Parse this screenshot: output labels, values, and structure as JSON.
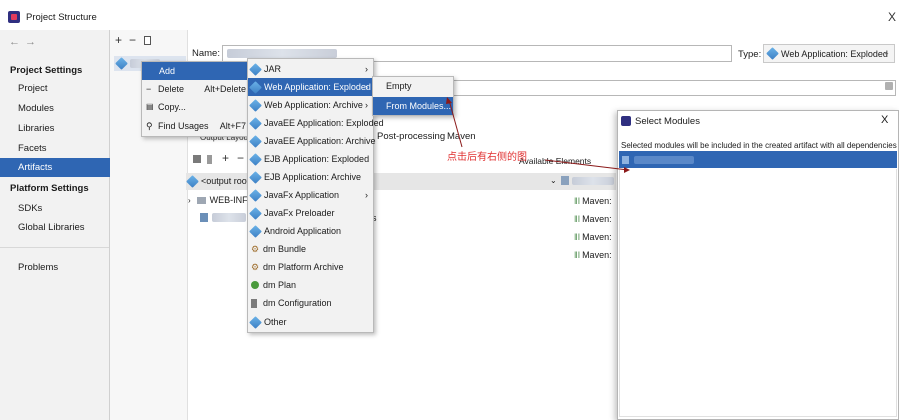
{
  "window": {
    "title": "Project Structure",
    "close": "X"
  },
  "nav": {
    "back": "←",
    "forward": "→"
  },
  "sidebar": {
    "project_settings": "Project Settings",
    "project_items": [
      {
        "label": "Project"
      },
      {
        "label": "Modules"
      },
      {
        "label": "Libraries"
      },
      {
        "label": "Facets"
      },
      {
        "label": "Artifacts"
      }
    ],
    "platform_settings": "Platform Settings",
    "platform_items": [
      {
        "label": "SDKs"
      },
      {
        "label": "Global Libraries"
      }
    ],
    "problems": "Problems"
  },
  "toolbar": {
    "add": "+",
    "remove": "−",
    "copy_icon": "copy-icon"
  },
  "name_label": "Name:",
  "type": {
    "label": "Type:",
    "value": "Web Application: Exploded"
  },
  "context_menu": {
    "items": [
      {
        "label": "Add",
        "shortcut": ""
      },
      {
        "label": "Delete",
        "shortcut": "Alt+Delete"
      },
      {
        "label": "Copy...",
        "shortcut": ""
      },
      {
        "label": "Find Usages",
        "shortcut": "Alt+F7"
      }
    ]
  },
  "add_submenu": {
    "items": [
      {
        "label": "JAR"
      },
      {
        "label": "Web Application: Exploded"
      },
      {
        "label": "Web Application: Archive"
      },
      {
        "label": "JavaEE Application: Exploded"
      },
      {
        "label": "JavaEE Application: Archive"
      },
      {
        "label": "EJB Application: Exploded"
      },
      {
        "label": "EJB Application: Archive"
      },
      {
        "label": "JavaFx Application"
      },
      {
        "label": "JavaFx Preloader"
      },
      {
        "label": "Android Application"
      },
      {
        "label": "dm Bundle"
      },
      {
        "label": "dm Platform Archive"
      },
      {
        "label": "dm Plan"
      },
      {
        "label": "dm Configuration"
      },
      {
        "label": "Other"
      }
    ]
  },
  "exploded_submenu": {
    "items": [
      {
        "label": "Empty"
      },
      {
        "label": "From Modules..."
      }
    ]
  },
  "content": {
    "tab_output_layout": "Output Layout",
    "tab_post_processing": "Post-processing",
    "tab_maven": "Maven",
    "available_elements": "Available Elements",
    "root_label": "<output root>",
    "web_inf": "WEB-INF",
    "s_fragment": "s",
    "maven_items": [
      {
        "label": "Maven:"
      },
      {
        "label": "Maven:"
      },
      {
        "label": "Maven:"
      },
      {
        "label": "Maven:"
      }
    ]
  },
  "dialog": {
    "title": "Select Modules",
    "close": "X",
    "description": "Selected modules will be included in the created artifact with all dependencies"
  },
  "annotation": {
    "text": "点击后有右侧的图",
    "color": "#e03030"
  },
  "colors": {
    "selection": "#2f66b3",
    "sidebar_bg": "#f2f2f2"
  }
}
